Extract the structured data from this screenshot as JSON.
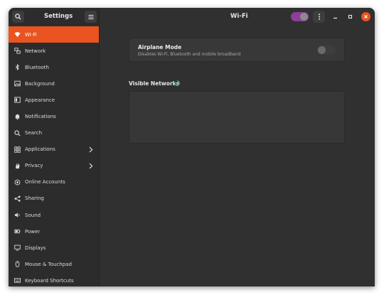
{
  "sidebar_header": {
    "title": "Settings",
    "search_icon": "search-icon",
    "menu_icon": "hamburger-menu-icon"
  },
  "main_header": {
    "title": "Wi-Fi",
    "theme_toggle_colors": [
      "#8b3f9a",
      "#8a8a8a"
    ],
    "menu_icon": "kebab-menu-icon"
  },
  "window_controls": [
    "minimize-icon",
    "maximize-icon",
    "close-icon"
  ],
  "accent_color": "#e95420",
  "sidebar": {
    "items": [
      {
        "label": "Wi-Fi",
        "icon": "wifi-icon",
        "active": true
      },
      {
        "label": "Network",
        "icon": "network-icon"
      },
      {
        "label": "Bluetooth",
        "icon": "bluetooth-icon"
      },
      {
        "label": "Background",
        "icon": "background-icon"
      },
      {
        "label": "Appearance",
        "icon": "appearance-icon"
      },
      {
        "label": "Notifications",
        "icon": "bell-icon"
      },
      {
        "label": "Search",
        "icon": "search-icon"
      },
      {
        "label": "Applications",
        "icon": "grid-icon",
        "chevron": true
      },
      {
        "label": "Privacy",
        "icon": "hand-icon",
        "chevron": true
      },
      {
        "label": "Online Accounts",
        "icon": "cloud-icon"
      },
      {
        "label": "Sharing",
        "icon": "share-icon"
      },
      {
        "label": "Sound",
        "icon": "speaker-icon"
      },
      {
        "label": "Power",
        "icon": "power-icon"
      },
      {
        "label": "Displays",
        "icon": "display-icon"
      },
      {
        "label": "Mouse & Touchpad",
        "icon": "mouse-icon"
      },
      {
        "label": "Keyboard Shortcuts",
        "icon": "keyboard-icon"
      }
    ]
  },
  "airplane": {
    "title": "Airplane Mode",
    "subtitle": "Disables Wi-Fi, Bluetooth and mobile broadband",
    "enabled": false
  },
  "visible_networks": {
    "title": "Visible Networks",
    "status_icon": "loading-spinner-icon"
  }
}
